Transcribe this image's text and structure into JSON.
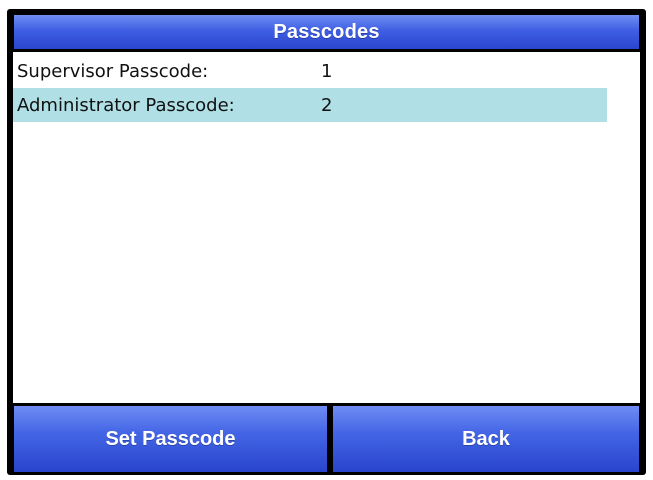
{
  "screen": {
    "title": "Passcodes"
  },
  "passcodes": [
    {
      "label": "Supervisor Passcode:",
      "value": "1",
      "selected": false
    },
    {
      "label": "Administrator Passcode:",
      "value": "2",
      "selected": true
    }
  ],
  "buttons": {
    "set_passcode": "Set Passcode",
    "back": "Back"
  },
  "colors": {
    "title_bar": "#3f5fe3",
    "selection": "#b0e0e6",
    "button": "#4466e6",
    "frame": "#000000"
  }
}
